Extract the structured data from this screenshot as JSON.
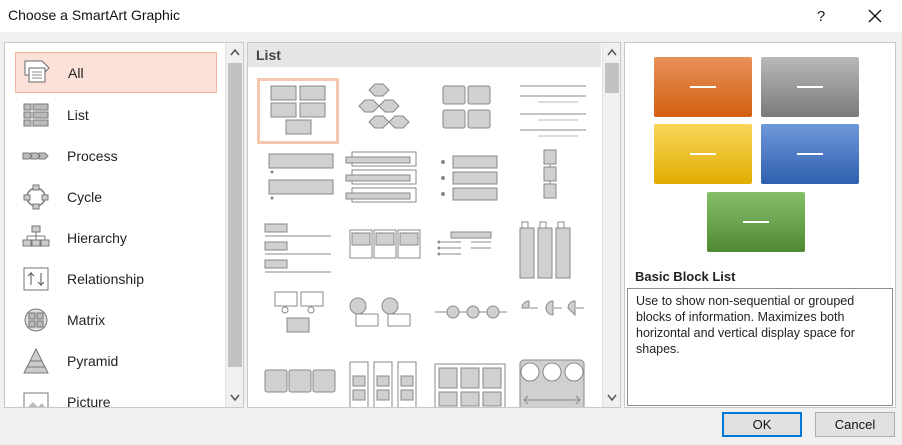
{
  "window": {
    "title": "Choose a SmartArt Graphic",
    "help_label": "?",
    "close_icon": "close-icon"
  },
  "categories": [
    {
      "label": "All",
      "icon": "all-icon",
      "selected": true
    },
    {
      "label": "List",
      "icon": "list-icon"
    },
    {
      "label": "Process",
      "icon": "process-icon"
    },
    {
      "label": "Cycle",
      "icon": "cycle-icon"
    },
    {
      "label": "Hierarchy",
      "icon": "hierarchy-icon"
    },
    {
      "label": "Relationship",
      "icon": "relationship-icon"
    },
    {
      "label": "Matrix",
      "icon": "matrix-icon"
    },
    {
      "label": "Pyramid",
      "icon": "pyramid-icon"
    },
    {
      "label": "Picture",
      "icon": "picture-icon"
    }
  ],
  "gallery": {
    "section_header": "List",
    "selected_layout": "Basic Block List"
  },
  "preview": {
    "title": "Basic Block List",
    "description": "Use to show non-sequential or grouped blocks of information. Maximizes both horizontal and vertical display space for shapes.",
    "block_colors": [
      "#e46c1e",
      "#8c8c8c",
      "#f2c014",
      "#3a6fbf",
      "#5b9a3d"
    ]
  },
  "buttons": {
    "ok": "OK",
    "cancel": "Cancel"
  },
  "colors": {
    "selection_bg": "#fbe1d8",
    "selection_border": "#f6c6ae",
    "accent": "#0078d7"
  }
}
